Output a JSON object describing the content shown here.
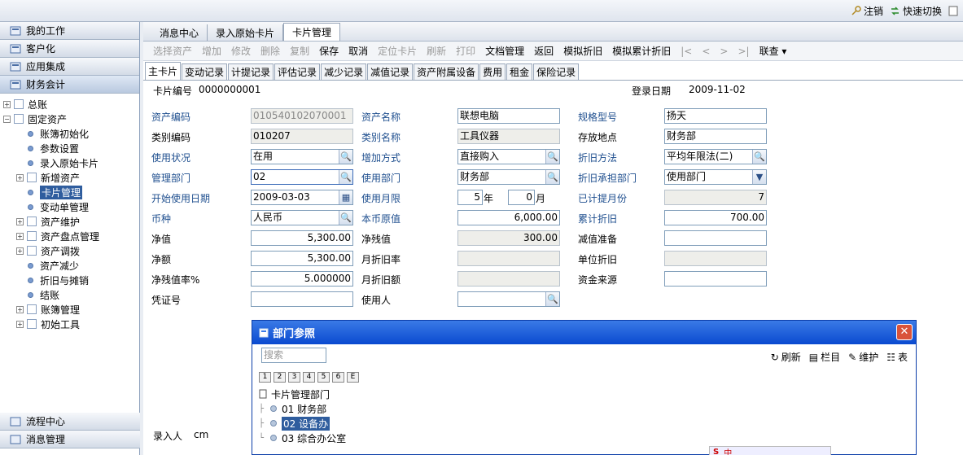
{
  "topbar": {
    "logout": "注销",
    "quick_switch": "快速切换"
  },
  "sidebar": {
    "heads_top": [
      "我的工作",
      "客户化",
      "应用集成",
      "财务会计"
    ],
    "tree": [
      {
        "label": "总账",
        "type": "folder",
        "level": 0,
        "expand": "+"
      },
      {
        "label": "固定资产",
        "type": "folder",
        "level": 0,
        "expand": "−"
      },
      {
        "label": "账簿初始化",
        "type": "leaf",
        "level": 1
      },
      {
        "label": "参数设置",
        "type": "leaf",
        "level": 1
      },
      {
        "label": "录入原始卡片",
        "type": "leaf",
        "level": 1
      },
      {
        "label": "新增资产",
        "type": "folder",
        "level": 1,
        "expand": "+"
      },
      {
        "label": "卡片管理",
        "type": "leaf",
        "level": 1,
        "selected": true
      },
      {
        "label": "变动单管理",
        "type": "leaf",
        "level": 1
      },
      {
        "label": "资产维护",
        "type": "folder",
        "level": 1,
        "expand": "+"
      },
      {
        "label": "资产盘点管理",
        "type": "folder",
        "level": 1,
        "expand": "+"
      },
      {
        "label": "资产调拨",
        "type": "folder",
        "level": 1,
        "expand": "+"
      },
      {
        "label": "资产减少",
        "type": "leaf",
        "level": 1
      },
      {
        "label": "折旧与摊销",
        "type": "leaf",
        "level": 1
      },
      {
        "label": "结账",
        "type": "leaf",
        "level": 1
      },
      {
        "label": "账簿管理",
        "type": "folder",
        "level": 1,
        "expand": "+"
      },
      {
        "label": "初始工具",
        "type": "folder",
        "level": 1,
        "expand": "+"
      }
    ],
    "heads_bottom": [
      "流程中心",
      "消息管理"
    ]
  },
  "tabs": [
    "消息中心",
    "录入原始卡片",
    "卡片管理"
  ],
  "toolbar": [
    {
      "label": "选择资产",
      "disabled": true
    },
    {
      "label": "增加",
      "disabled": true
    },
    {
      "label": "修改",
      "disabled": true
    },
    {
      "label": "删除",
      "disabled": true
    },
    {
      "label": "复制",
      "disabled": true
    },
    {
      "label": "保存",
      "disabled": false
    },
    {
      "label": "取消",
      "disabled": false
    },
    {
      "label": "定位卡片",
      "disabled": true
    },
    {
      "label": "刷新",
      "disabled": true
    },
    {
      "label": "打印",
      "disabled": true
    },
    {
      "label": "文档管理",
      "disabled": false
    },
    {
      "label": "返回",
      "disabled": false
    },
    {
      "label": "模拟折旧",
      "disabled": false
    },
    {
      "label": "模拟累计折旧",
      "disabled": false
    },
    {
      "label": "|<",
      "disabled": true
    },
    {
      "label": "<",
      "disabled": true
    },
    {
      "label": ">",
      "disabled": true
    },
    {
      "label": ">|",
      "disabled": true
    },
    {
      "label": "联查 ▾",
      "disabled": false
    }
  ],
  "subtabs": [
    "主卡片",
    "变动记录",
    "计提记录",
    "评估记录",
    "减少记录",
    "减值记录",
    "资产附属设备",
    "费用",
    "租金",
    "保险记录"
  ],
  "card": {
    "no_label": "卡片编号",
    "no_value": "0000000001",
    "date_label": "登录日期",
    "date_value": "2009-11-02"
  },
  "form": {
    "asset_code": {
      "label": "资产编码",
      "value": "010540102070001"
    },
    "asset_name": {
      "label": "资产名称",
      "value": "联想电脑"
    },
    "spec": {
      "label": "规格型号",
      "value": "扬天"
    },
    "category_code": {
      "label": "类别编码",
      "value": "010207"
    },
    "category_name": {
      "label": "类别名称",
      "value": "工具仪器"
    },
    "location": {
      "label": "存放地点",
      "value": "财务部"
    },
    "usage_status": {
      "label": "使用状况",
      "value": "在用"
    },
    "add_method": {
      "label": "增加方式",
      "value": "直接购入"
    },
    "depr_method": {
      "label": "折旧方法",
      "value": "平均年限法(二)"
    },
    "manage_dept": {
      "label": "管理部门",
      "value": "02"
    },
    "use_dept": {
      "label": "使用部门",
      "value": "财务部"
    },
    "depr_bearer": {
      "label": "折旧承担部门",
      "value": "使用部门"
    },
    "start_date": {
      "label": "开始使用日期",
      "value": "2009-03-03"
    },
    "use_months": {
      "label": "使用月限",
      "years": "5",
      "year_unit": "年",
      "months": "0",
      "month_unit": "月"
    },
    "accrued_months": {
      "label": "已计提月份",
      "value": "7"
    },
    "currency": {
      "label": "币种",
      "value": "人民币"
    },
    "original_value": {
      "label": "本币原值",
      "value": "6,000.00"
    },
    "accum_depr": {
      "label": "累计折旧",
      "value": "700.00"
    },
    "net_value": {
      "label": "净值",
      "value": "5,300.00"
    },
    "net_residual": {
      "label": "净残值",
      "value": "300.00"
    },
    "impairment": {
      "label": "减值准备",
      "value": ""
    },
    "net_amount": {
      "label": "净额",
      "value": "5,300.00"
    },
    "monthly_rate": {
      "label": "月折旧率",
      "value": ""
    },
    "unit_depr": {
      "label": "单位折旧",
      "value": ""
    },
    "residual_rate": {
      "label": "净残值率%",
      "value": "5.000000"
    },
    "monthly_amount": {
      "label": "月折旧额",
      "value": ""
    },
    "fund_source": {
      "label": "资金来源",
      "value": ""
    },
    "voucher_no": {
      "label": "凭证号",
      "value": ""
    },
    "user": {
      "label": "使用人",
      "value": ""
    }
  },
  "footer": {
    "entry_label": "录入人",
    "entry_value": "cm"
  },
  "dialog": {
    "title": "部门参照",
    "search_placeholder": "搜索",
    "tools": [
      "刷新",
      "栏目",
      "维护",
      "表"
    ],
    "levels": [
      "1",
      "2",
      "3",
      "4",
      "5",
      "6",
      "E"
    ],
    "root": "卡片管理部门",
    "items": [
      {
        "label": "01 财务部",
        "selected": false
      },
      {
        "label": "02 设备办",
        "selected": true
      },
      {
        "label": "03 综合办公室",
        "selected": false
      }
    ]
  },
  "ime": {
    "s": "S",
    "c": "中"
  }
}
